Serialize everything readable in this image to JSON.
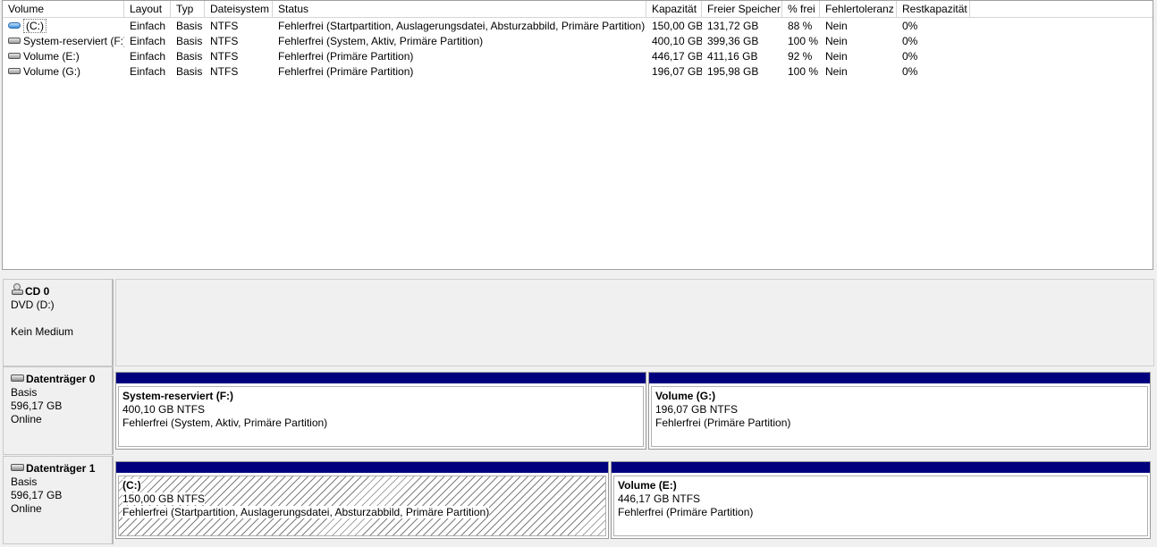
{
  "columns": [
    {
      "label": "Volume"
    },
    {
      "label": "Layout"
    },
    {
      "label": "Typ"
    },
    {
      "label": "Dateisystem"
    },
    {
      "label": "Status"
    },
    {
      "label": "Kapazität"
    },
    {
      "label": "Freier Speicher"
    },
    {
      "label": "% frei"
    },
    {
      "label": "Fehlertoleranz"
    },
    {
      "label": "Restkapazität"
    }
  ],
  "volumes": [
    {
      "name": "(C:)",
      "icon": "system-volume-icon",
      "layout": "Einfach",
      "typ": "Basis",
      "fs": "NTFS",
      "status": "Fehlerfrei (Startpartition, Auslagerungsdatei, Absturzabbild, Primäre Partition)",
      "capacity": "150,00 GB",
      "free": "131,72 GB",
      "pct_free": "88 %",
      "fault": "Nein",
      "overhead": "0%"
    },
    {
      "name": "System-reserviert (F:)",
      "icon": "volume-icon",
      "layout": "Einfach",
      "typ": "Basis",
      "fs": "NTFS",
      "status": "Fehlerfrei (System, Aktiv, Primäre Partition)",
      "capacity": "400,10 GB",
      "free": "399,36 GB",
      "pct_free": "100 %",
      "fault": "Nein",
      "overhead": "0%"
    },
    {
      "name": "Volume (E:)",
      "icon": "volume-icon",
      "layout": "Einfach",
      "typ": "Basis",
      "fs": "NTFS",
      "status": "Fehlerfrei (Primäre Partition)",
      "capacity": "446,17 GB",
      "free": "411,16 GB",
      "pct_free": "92 %",
      "fault": "Nein",
      "overhead": "0%"
    },
    {
      "name": "Volume (G:)",
      "icon": "volume-icon",
      "layout": "Einfach",
      "typ": "Basis",
      "fs": "NTFS",
      "status": "Fehlerfrei (Primäre Partition)",
      "capacity": "196,07 GB",
      "free": "195,98 GB",
      "pct_free": "100 %",
      "fault": "Nein",
      "overhead": "0%"
    }
  ],
  "disks": [
    {
      "title": "CD 0",
      "icon": "cd-drive-icon",
      "line1": "DVD (D:)",
      "line2": "",
      "line3": "Kein Medium",
      "partitions": []
    },
    {
      "title": "Datenträger 0",
      "icon": "disk-icon",
      "line1": "Basis",
      "line2": "596,17 GB",
      "line3": "Online",
      "partitions": [
        {
          "name": "System-reserviert  (F:)",
          "size": "400,10 GB NTFS",
          "status": "Fehlerfrei (System, Aktiv, Primäre Partition)",
          "hatched": false
        },
        {
          "name": "Volume  (G:)",
          "size": "196,07 GB NTFS",
          "status": "Fehlerfrei (Primäre Partition)",
          "hatched": false
        }
      ]
    },
    {
      "title": "Datenträger 1",
      "icon": "disk-icon",
      "line1": "Basis",
      "line2": "596,17 GB",
      "line3": "Online",
      "partitions": [
        {
          "name": " (C:)",
          "size": "150,00 GB NTFS",
          "status": "Fehlerfrei (Startpartition, Auslagerungsdatei, Absturzabbild, Primäre Partition)",
          "hatched": true
        },
        {
          "name": "Volume  (E:)",
          "size": "446,17 GB NTFS",
          "status": "Fehlerfrei (Primäre Partition)",
          "hatched": false
        }
      ]
    }
  ],
  "colors": {
    "partition_bar": "#00007f",
    "background": "#f0f0f0"
  }
}
